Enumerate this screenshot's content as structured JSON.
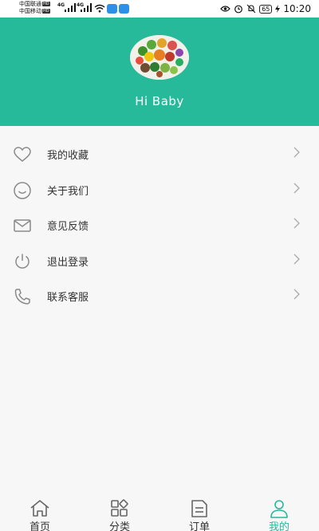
{
  "status_bar": {
    "carrier1": "中国联通",
    "carrier2": "中国移动",
    "hd": "HD",
    "net1": "4G",
    "net2": "4G",
    "battery": "65",
    "time": "10:20"
  },
  "profile": {
    "greeting": "Hi Baby"
  },
  "menu": {
    "items": [
      {
        "label": "我的收藏",
        "icon": "heart-icon"
      },
      {
        "label": "关于我们",
        "icon": "smile-icon"
      },
      {
        "label": "意见反馈",
        "icon": "mail-icon"
      },
      {
        "label": "退出登录",
        "icon": "power-icon"
      },
      {
        "label": "联系客服",
        "icon": "phone-icon"
      }
    ]
  },
  "tabs": [
    {
      "label": "首页",
      "icon": "home-icon"
    },
    {
      "label": "分类",
      "icon": "category-icon"
    },
    {
      "label": "订单",
      "icon": "order-icon"
    },
    {
      "label": "我的",
      "icon": "user-icon",
      "active": true
    }
  ],
  "colors": {
    "accent": "#26b99a",
    "icon_gray": "#8a8a8a",
    "text": "#333333"
  }
}
